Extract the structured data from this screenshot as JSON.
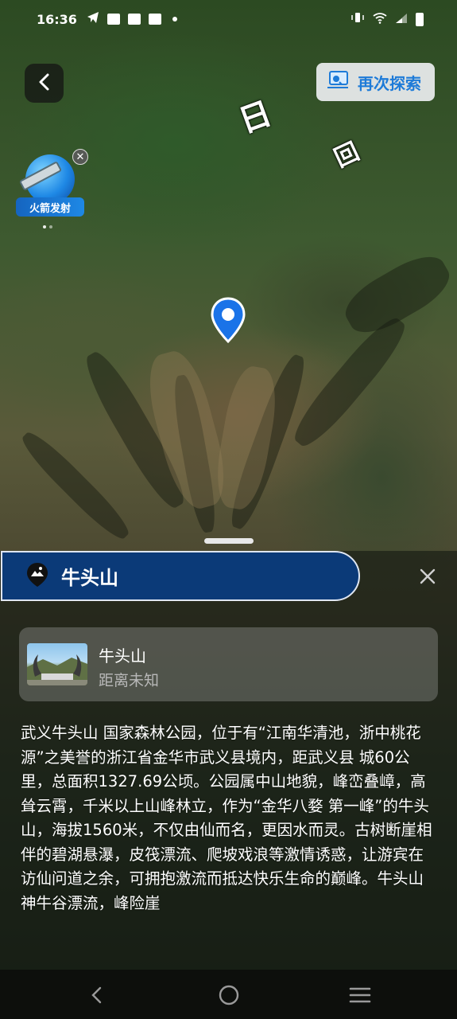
{
  "status_bar": {
    "time": "16:36"
  },
  "header": {
    "explore_again_label": "再次探索"
  },
  "rocket_badge": {
    "label": "火箭发射"
  },
  "map_labels": [
    {
      "text": "日"
    },
    {
      "text": "回"
    }
  ],
  "sheet": {
    "title": "牛头山",
    "poi": {
      "name": "牛头山",
      "distance": "距离未知"
    },
    "description": "武义牛头山 国家森林公园，位于有“江南华清池，浙中桃花源”之美誉的浙江省金华市武义县境内，距武义县 城60公里，总面积1327.69公顷。公园属中山地貌，峰峦叠嶂，高耸云霄，千米以上山峰林立，作为“金华八婺 第一峰”的牛头山，海拔1560米，不仅由仙而名，更因水而灵。古树断崖相伴的碧湖悬瀑，皮筏漂流、爬坡戏浪等激情诱惑，让游宾在访仙问道之余，可拥抱激流而抵达快乐生命的巅峰。牛头山神牛谷漂流，峰险崖"
  },
  "colors": {
    "accent_blue": "#0b3a78",
    "explore_text": "#1e7bd8",
    "pin_blue": "#1a73e8"
  }
}
